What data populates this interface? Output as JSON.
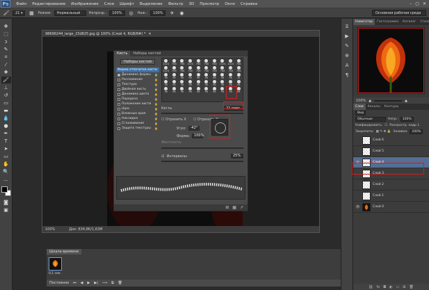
{
  "menubar": {
    "logo": "Ps",
    "items": [
      "Файл",
      "Редактирование",
      "Изображение",
      "Слои",
      "Шрифт",
      "Выделение",
      "Фильтр",
      "3D",
      "Просмотр",
      "Окно",
      "Справка"
    ],
    "window_controls": [
      "–",
      "▢",
      "✕"
    ]
  },
  "options": {
    "mode_label": "Режим:",
    "mode_value": "Нормальный",
    "opacity_label": "Непрозр.:",
    "opacity_value": "100%",
    "flow_label": "Наж.:",
    "flow_value": "100%",
    "workspace": "Основная рабочая среда"
  },
  "document": {
    "tab_title": "98696244_large_23d825.jpg @ 100% (Слой 4, RGB/8#) *",
    "zoom": "100%",
    "doc_info": "Док: 834,8К/1,63М"
  },
  "brush_panel": {
    "tabs": [
      "Кисть",
      "Наборы кистей"
    ],
    "presets_button": "Наборы кистей",
    "options": [
      {
        "label": "Форма отпечатка кисти",
        "checked": false,
        "highlight": true
      },
      {
        "label": "Динамика формы",
        "checked": true
      },
      {
        "label": "Рассеивание",
        "checked": false
      },
      {
        "label": "Текстура",
        "checked": false
      },
      {
        "label": "Двойная кисть",
        "checked": false
      },
      {
        "label": "Динамика цвета",
        "checked": false
      },
      {
        "label": "Передача",
        "checked": false
      },
      {
        "label": "Положение кисти",
        "checked": false
      },
      {
        "label": "Шум",
        "checked": false
      },
      {
        "label": "Влажные края",
        "checked": false
      },
      {
        "label": "Накладка",
        "checked": false
      },
      {
        "label": "Сглаживание",
        "checked": false
      },
      {
        "label": "Защита текстуры",
        "checked": false
      }
    ],
    "tip_sizes": [
      "1024",
      "768",
      "768",
      "1024",
      "768",
      "768",
      "768",
      "1024",
      "1024",
      "768",
      "1024",
      "768",
      "768",
      "768",
      "768",
      "768",
      "768",
      "768",
      "768",
      "768",
      "96",
      "96",
      "96",
      "96",
      "96",
      "96",
      "96",
      "96",
      "96",
      "15",
      "96",
      "96",
      "96",
      "96",
      "96",
      "96",
      "96",
      "96",
      "96",
      "96",
      "96",
      "96",
      "96",
      "96",
      "96",
      "96",
      "96",
      "96",
      "96",
      "96"
    ],
    "size_label": "Кегль",
    "size_value": "21 пикс.",
    "flip_x": "Отразить X",
    "flip_y": "Отразить Y",
    "angle_label": "Угол:",
    "angle_value": "-42°",
    "roundness_label": "Форма:",
    "roundness_value": "100%",
    "hardness_label": "Жесткость",
    "spacing_label": "Интервалы",
    "spacing_value": "25%"
  },
  "timeline": {
    "title": "Шкала времени",
    "frame_time": "0,1 сек.",
    "loop": "Постоянно"
  },
  "navigator": {
    "tabs": [
      "Навигатор",
      "Гистограмма",
      "Каталог",
      "Стили"
    ],
    "zoom": "100%"
  },
  "layers": {
    "tabs": [
      "Слои",
      "Каналы",
      "Контуры"
    ],
    "kind": "Вид",
    "blend": "Обычные",
    "opacity_label": "Непр.:",
    "opacity": "100%",
    "unify_label": "Унифицировать:",
    "propagate": "Распростр. кадр 1",
    "lock_label": "Закрепить:",
    "fill_label": "Заливка:",
    "fill": "100%",
    "items": [
      {
        "name": "Слой 6",
        "selected": false,
        "visible": false,
        "bg": false
      },
      {
        "name": "Слой 5",
        "selected": false,
        "visible": false,
        "bg": false
      },
      {
        "name": "Слой 4",
        "selected": true,
        "visible": true,
        "bg": false
      },
      {
        "name": "Слой 3",
        "selected": false,
        "visible": false,
        "bg": false
      },
      {
        "name": "Слой 2",
        "selected": false,
        "visible": false,
        "bg": false
      },
      {
        "name": "Слой 1",
        "selected": false,
        "visible": false,
        "bg": false
      },
      {
        "name": "Слой 0",
        "selected": false,
        "visible": true,
        "bg": true
      }
    ]
  },
  "colors": {
    "accent": "#d42020",
    "selection": "#546e94",
    "panel": "#4a4a4a"
  }
}
